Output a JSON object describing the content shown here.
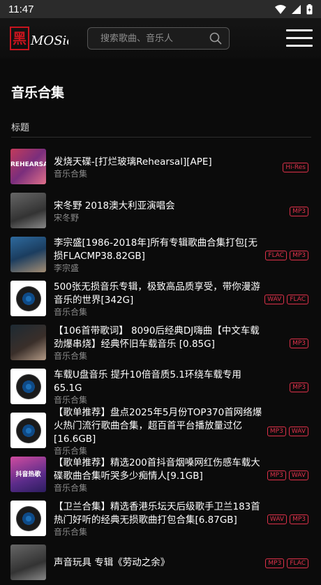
{
  "status": {
    "time": "11:47"
  },
  "header": {
    "logo_text": "黑",
    "logo_word": "MOSic",
    "search_placeholder": "搜索歌曲、音乐人"
  },
  "page": {
    "title": "音乐合集",
    "column_header": "标题"
  },
  "items": [
    {
      "title": "发烧天碟-[打烂玻璃Rehearsal][APE]",
      "subtitle": "音乐合集",
      "tags": [
        "Hi-Res"
      ],
      "cover": "photo1",
      "cover_text": "REHEARSAL"
    },
    {
      "title": "宋冬野 2018澳大利亚演唱会",
      "subtitle": "宋冬野",
      "tags": [
        "MP3"
      ],
      "cover": "photo2",
      "cover_text": ""
    },
    {
      "title": "李宗盛[1986-2018年]所有专辑歌曲合集打包[无损FLACMP38.82GB]",
      "subtitle": "李宗盛",
      "tags": [
        "FLAC",
        "MP3"
      ],
      "cover": "photo3",
      "cover_text": ""
    },
    {
      "title": "500张无损音乐专辑，极致高品质享受，带你漫游音乐的世界[342G]",
      "subtitle": "音乐合集",
      "tags": [
        "WAV",
        "FLAC"
      ],
      "cover": "vinyl",
      "cover_text": ""
    },
    {
      "title": "【106首带歌词】 8090后经典DJ嗨曲【中文车载劲爆串烧】经典怀旧车载音乐 [0.85G]",
      "subtitle": "音乐合集",
      "tags": [
        "MP3"
      ],
      "cover": "photo4",
      "cover_text": ""
    },
    {
      "title": "车载U盘音乐 提升10倍音质5.1环绕车载专用 65.1G",
      "subtitle": "音乐合集",
      "tags": [
        "MP3"
      ],
      "cover": "vinyl",
      "cover_text": ""
    },
    {
      "title": "【歌单推荐】盘点2025年5月份TOP370首网络爆火热门流行歌曲合集，超百首平台播放量过亿[16.6GB]",
      "subtitle": "音乐合集",
      "tags": [
        "MP3",
        "WAV"
      ],
      "cover": "vinyl",
      "cover_text": ""
    },
    {
      "title": "【歌单推荐】精选200首抖音烟嗓网红伤感车载大碟歌曲合集听哭多少痴情人[9.1GB]",
      "subtitle": "音乐合集",
      "tags": [
        "MP3",
        "WAV"
      ],
      "cover": "photo5",
      "cover_text": "抖音热歌"
    },
    {
      "title": "【卫兰合集】精选香港乐坛天后级歌手卫兰183首热门好听的经典无损歌曲打包合集[6.87GB]",
      "subtitle": "音乐合集",
      "tags": [
        "WAV",
        "MP3"
      ],
      "cover": "vinyl",
      "cover_text": ""
    },
    {
      "title": "声音玩具 专辑《劳动之余》",
      "subtitle": "",
      "tags": [
        "MP3",
        "FLAC"
      ],
      "cover": "photo2",
      "cover_text": ""
    }
  ],
  "colors": {
    "tag": "#e0314a",
    "background": "#0b0b0b",
    "logo_red": "#c8141e"
  }
}
